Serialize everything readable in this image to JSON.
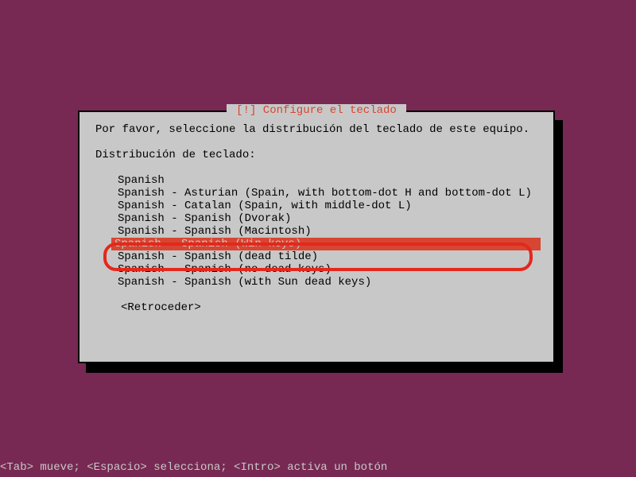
{
  "dialog": {
    "title": " [!] Configure el teclado ",
    "instruction": "Por favor, seleccione la distribución del teclado de este equipo.",
    "prompt": "Distribución de teclado:",
    "items": [
      "Spanish",
      "Spanish - Asturian (Spain, with bottom-dot H and bottom-dot L)",
      "Spanish - Catalan (Spain, with middle-dot L)",
      "Spanish - Spanish (Dvorak)",
      "Spanish - Spanish (Macintosh)",
      "Spanish - Spanish (Win keys)",
      "Spanish - Spanish (dead tilde)",
      "Spanish - Spanish (no dead keys)",
      "Spanish - Spanish (with Sun dead keys)"
    ],
    "selected_index": 5,
    "back_label": "<Retroceder>"
  },
  "statusbar": "<Tab> mueve; <Espacio> selecciona; <Intro> activa un botón"
}
